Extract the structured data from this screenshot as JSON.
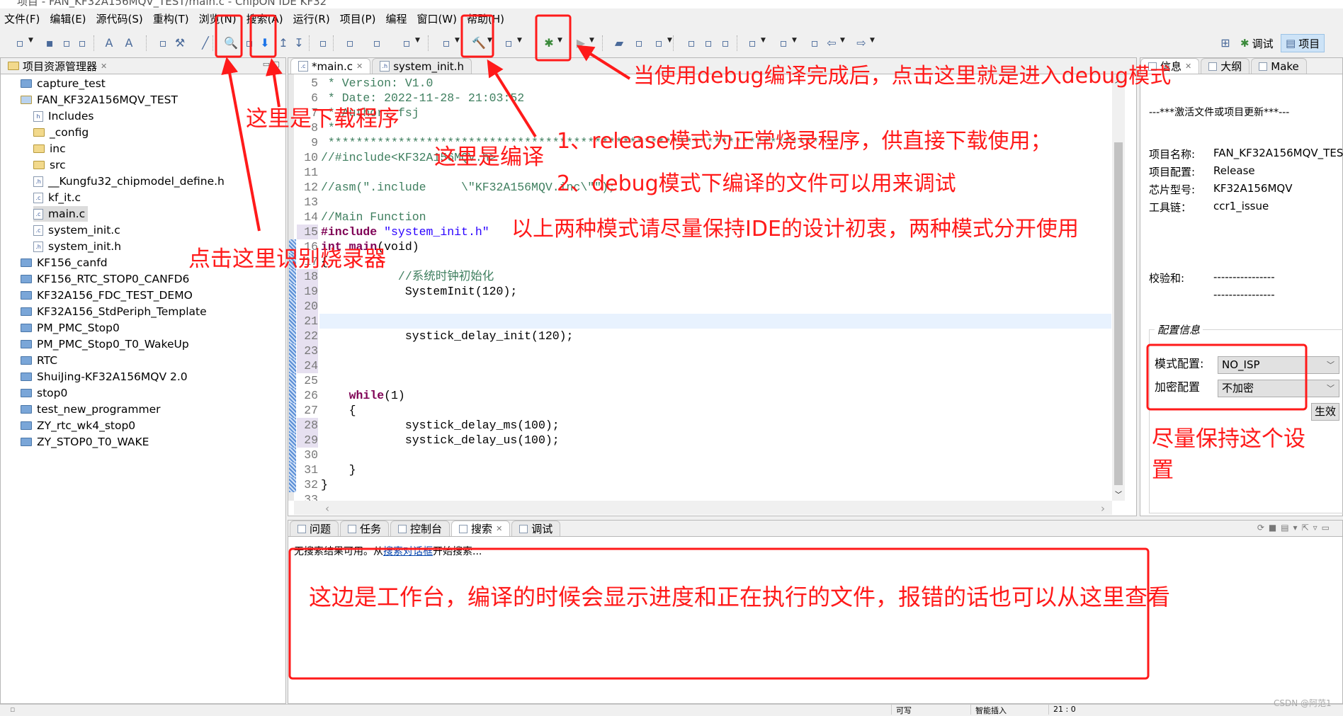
{
  "window": {
    "title": "项目 - FAN_KF32A156MQV_TEST/main.c - ChipON IDE KF32"
  },
  "menu": [
    "文件(F)",
    "编辑(E)",
    "源代码(S)",
    "重构(T)",
    "浏览(N)",
    "搜索(A)",
    "运行(R)",
    "项目(P)",
    "编程",
    "窗口(W)",
    "帮助(H)"
  ],
  "toolbar": {
    "icons": [
      "new-icon",
      "save-icon",
      "save-all-icon",
      "print-icon",
      "font-decrease-icon",
      "font-increase-icon",
      "edit-icon",
      "wrench-icon",
      "brush-icon",
      "recognize-programmer-icon",
      "at-icon",
      "download-icon",
      "step-up-icon",
      "step-down-icon",
      "format-icon",
      "new-c-project-icon",
      "new-c-file-icon",
      "new-c-class-icon",
      "target-icon",
      "build-hammer-icon",
      "build-all-icon",
      "debug-bug-icon",
      "run-icon",
      "open-folder-icon",
      "open-file-icon",
      "torch-icon",
      "highlight-icon",
      "block-icon",
      "paragraph-icon",
      "next-annotation-icon",
      "prev-annotation-icon",
      "last-edit-icon",
      "back-icon",
      "forward-icon"
    ],
    "perspectives": [
      {
        "label": "调试",
        "active": false
      },
      {
        "label": "项目",
        "active": true
      }
    ]
  },
  "explorer": {
    "title": "项目资源管理器",
    "items": [
      {
        "label": "capture_test",
        "type": "project",
        "depth": 0
      },
      {
        "label": "FAN_KF32A156MQV_TEST",
        "type": "open-project",
        "depth": 0
      },
      {
        "label": "Includes",
        "type": "includes",
        "depth": 1
      },
      {
        "label": "_config",
        "type": "folder",
        "depth": 1
      },
      {
        "label": "inc",
        "type": "folder",
        "depth": 1
      },
      {
        "label": "src",
        "type": "folder",
        "depth": 1
      },
      {
        "label": "__Kungfu32_chipmodel_define.h",
        "type": "h",
        "depth": 1
      },
      {
        "label": "kf_it.c",
        "type": "c",
        "depth": 1
      },
      {
        "label": "main.c",
        "type": "c",
        "depth": 1,
        "selected": true
      },
      {
        "label": "system_init.c",
        "type": "c",
        "depth": 1
      },
      {
        "label": "system_init.h",
        "type": "h",
        "depth": 1
      },
      {
        "label": "KF156_canfd",
        "type": "project",
        "depth": 0
      },
      {
        "label": "KF156_RTC_STOP0_CANFD6",
        "type": "project",
        "depth": 0
      },
      {
        "label": "KF32A156_FDC_TEST_DEMO",
        "type": "project",
        "depth": 0
      },
      {
        "label": "KF32A156_StdPeriph_Template",
        "type": "project",
        "depth": 0
      },
      {
        "label": "PM_PMC_Stop0",
        "type": "project",
        "depth": 0
      },
      {
        "label": "PM_PMC_Stop0_T0_WakeUp",
        "type": "project",
        "depth": 0
      },
      {
        "label": "RTC",
        "type": "project",
        "depth": 0
      },
      {
        "label": "ShuiJing-KF32A156MQV 2.0",
        "type": "project",
        "depth": 0
      },
      {
        "label": "stop0",
        "type": "project",
        "depth": 0
      },
      {
        "label": "test_new_programmer",
        "type": "project",
        "depth": 0
      },
      {
        "label": "ZY_rtc_wk4_stop0",
        "type": "project",
        "depth": 0
      },
      {
        "label": "ZY_STOP0_T0_WAKE",
        "type": "project",
        "depth": 0
      }
    ]
  },
  "editor": {
    "tabs": [
      {
        "label": "*main.c",
        "active": true,
        "type": "c"
      },
      {
        "label": "system_init.h",
        "active": false,
        "type": "h"
      }
    ],
    "current_line": 21,
    "lines": [
      {
        "n": 5,
        "segs": [
          [
            "cm",
            " * Version: V1.0"
          ]
        ]
      },
      {
        "n": 6,
        "segs": [
          [
            "cm",
            " * Date: 2022-11-28- 21:03:52"
          ]
        ]
      },
      {
        "n": 7,
        "segs": [
          [
            "cm",
            " * Author: fsj"
          ]
        ]
      },
      {
        "n": 8,
        "segs": [
          [
            "cm",
            " *"
          ]
        ]
      },
      {
        "n": 9,
        "segs": [
          [
            "cm",
            " *************************************************************************"
          ]
        ]
      },
      {
        "n": 10,
        "segs": [
          [
            "cm",
            "//#include<KF32A156MQV.h>"
          ]
        ]
      },
      {
        "n": 11,
        "segs": []
      },
      {
        "n": 12,
        "segs": [
          [
            "cm",
            "//asm(\".include     \\\"KF32A156MQV.inc\\\"\");"
          ]
        ]
      },
      {
        "n": 13,
        "segs": []
      },
      {
        "n": 14,
        "segs": [
          [
            "cm",
            "//Main Function"
          ]
        ]
      },
      {
        "n": 15,
        "segs": [
          [
            "kw",
            "#include"
          ],
          [
            "",
            ""
          ],
          [
            "st",
            " \"system_init.h\""
          ]
        ]
      },
      {
        "n": 16,
        "segs": [
          [
            "kw",
            "int"
          ],
          [
            "",
            " "
          ],
          [
            "kw",
            "main"
          ],
          [
            "",
            "(void)"
          ]
        ]
      },
      {
        "n": 17,
        "segs": [
          [
            "",
            "{"
          ]
        ]
      },
      {
        "n": 18,
        "segs": [
          [
            "cm",
            "           //系统时钟初始化"
          ]
        ]
      },
      {
        "n": 19,
        "segs": [
          [
            "",
            "            SystemInit(120);"
          ]
        ]
      },
      {
        "n": 20,
        "segs": []
      },
      {
        "n": 21,
        "segs": []
      },
      {
        "n": 22,
        "segs": [
          [
            "",
            "            systick_delay_init(120);"
          ]
        ]
      },
      {
        "n": 23,
        "segs": []
      },
      {
        "n": 24,
        "segs": []
      },
      {
        "n": 25,
        "segs": []
      },
      {
        "n": 26,
        "segs": [
          [
            "",
            "    "
          ],
          [
            "kw",
            "while"
          ],
          [
            "",
            "(1)"
          ]
        ]
      },
      {
        "n": 27,
        "segs": [
          [
            "",
            "    {"
          ]
        ]
      },
      {
        "n": 28,
        "segs": [
          [
            "",
            "            systick_delay_ms(100);"
          ]
        ]
      },
      {
        "n": 29,
        "segs": [
          [
            "",
            "            systick_delay_us(100);"
          ]
        ]
      },
      {
        "n": 30,
        "segs": []
      },
      {
        "n": 31,
        "segs": [
          [
            "",
            "    }"
          ]
        ]
      },
      {
        "n": 32,
        "segs": [
          [
            "",
            "}"
          ]
        ]
      },
      {
        "n": 33,
        "segs": []
      }
    ]
  },
  "info_panel": {
    "tabs": [
      {
        "label": "信息",
        "active": true
      },
      {
        "label": "大纲"
      },
      {
        "label": "Make"
      }
    ],
    "header": "---***激活文件或项目更新***---",
    "rows": [
      {
        "label": "项目名称:",
        "value": "FAN_KF32A156MQV_TEST"
      },
      {
        "label": "项目配置:",
        "value": "Release"
      },
      {
        "label": "芯片型号:",
        "value": "KF32A156MQV"
      },
      {
        "label": "工具链：",
        "value": "ccr1_issue"
      }
    ],
    "checksum_label": "校验和:",
    "checksum_values": [
      "----------------",
      "----------------"
    ],
    "config_group": "配置信息",
    "mode_label": "模式配置:",
    "mode_value": "NO_ISP",
    "encrypt_label": "加密配置",
    "encrypt_value": "不加密",
    "apply_button": "生效"
  },
  "bottom_panel": {
    "tabs": [
      {
        "label": "问题"
      },
      {
        "label": "任务"
      },
      {
        "label": "控制台"
      },
      {
        "label": "搜索",
        "active": true
      },
      {
        "label": "调试"
      }
    ],
    "message_pre": "无搜索结果可用。从",
    "message_link": "搜索对话框",
    "message_post": "开始搜索..."
  },
  "status_bar": {
    "writable": "可写",
    "insert_mode": "智能插入",
    "position": "21 : 0"
  },
  "watermark": "CSDN @阿范1",
  "annotations": {
    "download": "这里是下载程序",
    "compile": "这里是编译",
    "recognize": "点击这里识别烧录器",
    "debug_enter": "当使用debug编译完成后，点击这里就是进入debug模式",
    "note1": "1、release模式为正常烧录程序，供直接下载使用；",
    "note2": "2、debug模式下编译的文件可以用来调试",
    "note3": "以上两种模式请尽量保持IDE的设计初衷，两种模式分开使用",
    "keep_setting_1": "尽量保持这个设",
    "keep_setting_2": "置",
    "console": "这边是工作台，编译的时候会显示进度和正在执行的文件，报错的话也可以从这里查看",
    "color": "#ff1a1a"
  }
}
